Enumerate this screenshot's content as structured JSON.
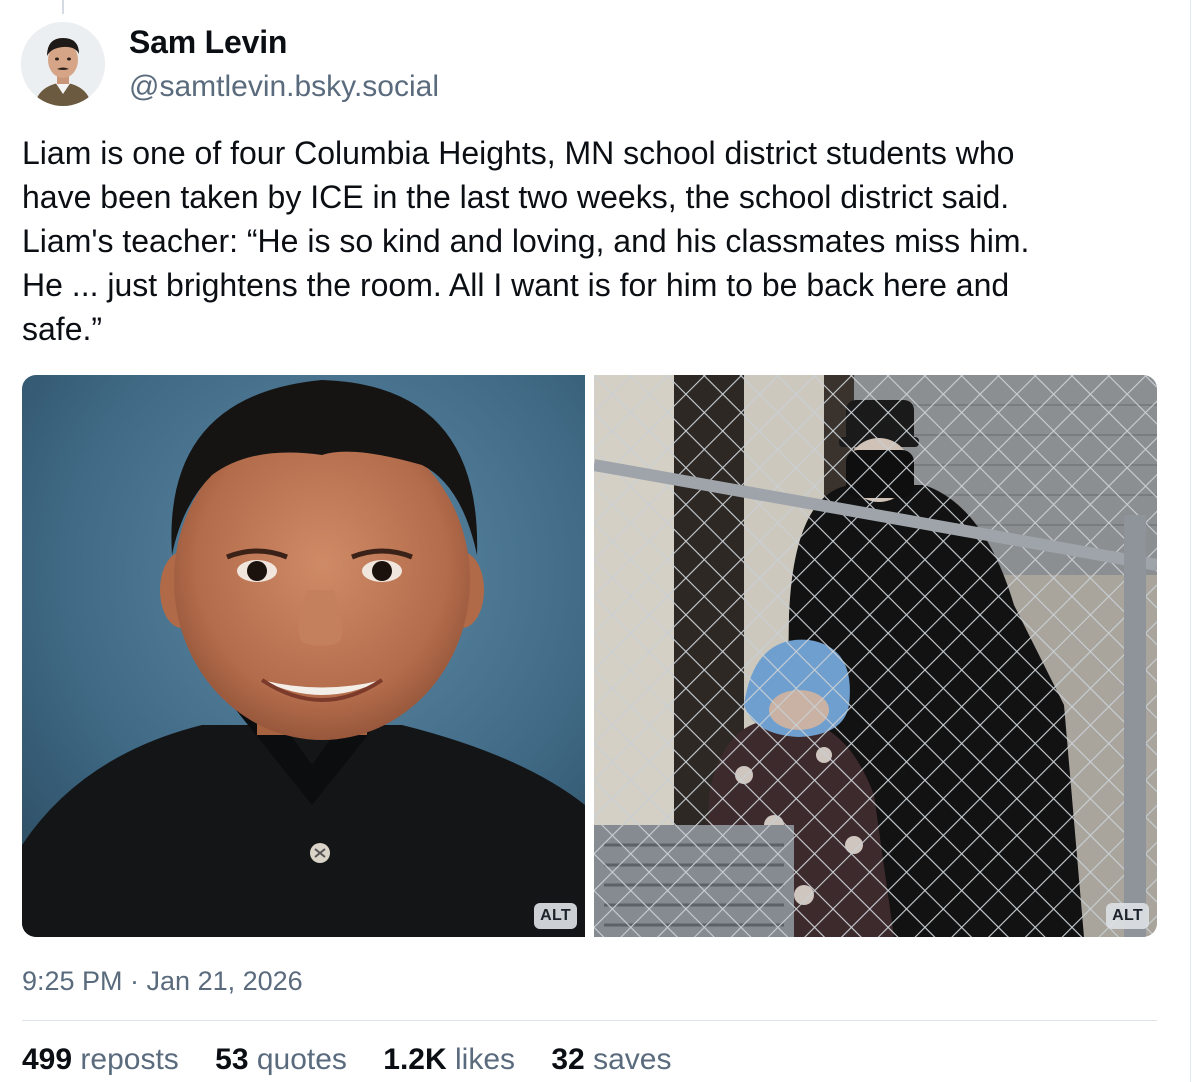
{
  "author": {
    "display_name": "Sam Levin",
    "handle": "@samtlevin.bsky.social"
  },
  "post": {
    "text_lines": [
      "Liam is one of four Columbia Heights, MN school district students who",
      "have been taken by ICE in the last two weeks, the school district said.",
      "Liam's teacher: “He is so kind and loving, and his classmates miss him.",
      "He ... just brightens the room. All I want is for him to be back here and",
      "safe.”"
    ],
    "images": [
      {
        "alt_badge": "ALT"
      },
      {
        "alt_badge": "ALT"
      }
    ],
    "timestamp": "9:25 PM · Jan 21, 2026"
  },
  "stats": [
    {
      "count": "499",
      "label": "reposts"
    },
    {
      "count": "53",
      "label": "quotes"
    },
    {
      "count": "1.2K",
      "label": "likes"
    },
    {
      "count": "32",
      "label": "saves"
    }
  ]
}
